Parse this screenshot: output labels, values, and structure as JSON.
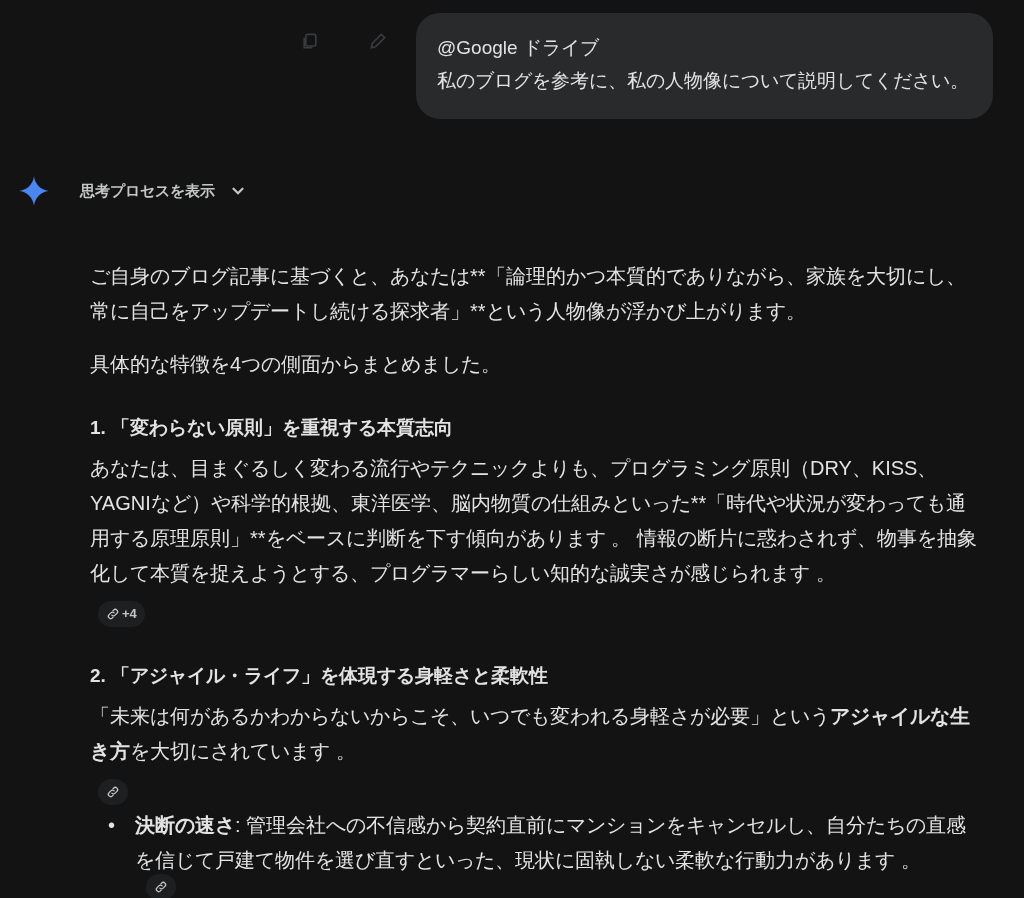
{
  "message_actions": [
    {
      "kind": "copy"
    },
    {
      "kind": "edit"
    }
  ],
  "user_message": {
    "mention": "@Google ドライブ",
    "text": "私のブログを参考に、私の人物像について説明してください。"
  },
  "thinking_toggle": {
    "label": "思考プロセスを表示",
    "expanded": false
  },
  "response": [
    {
      "kind": "plain",
      "text": "ご自身のブログ記事に基づくと、あなたは**「論理的かつ本質的でありながら、家族を大切にし、常に自己をアップデートし続ける探求者」**という人物像が浮かび上がります。"
    },
    {
      "kind": "plain",
      "text": "具体的な特徴を4つの側面からまとめました。"
    },
    {
      "kind": "heading",
      "text": "1. 「変わらない原則」を重視する本質志向"
    },
    {
      "kind": "plain",
      "text": "あなたは、目まぐるしく変わる流行やテクニックよりも、プログラミング原則（DRY、KISS、YAGNIなど）や科学的根拠、東洋医学、脳内物質の仕組みといった**「時代や状況が変わっても通用する原理原則」**をベースに判断を下す傾向があります 。 情報の断片に惑わされず、物事を抽象化して本質を捉えようとする、プログラマーらしい知的な誠実さが感じられます 。"
    },
    {
      "kind": "citation",
      "label": "+4"
    },
    {
      "kind": "heading",
      "text": "2. 「アジャイル・ライフ」を体現する身軽さと柔軟性"
    },
    {
      "kind": "rich",
      "text": "「未来は何があるかわからないからこそ、いつでも変われる身軽さが必要」という**アジャイルな生き方**を大切にされています 。"
    },
    {
      "kind": "citation"
    },
    {
      "kind": "bullet",
      "marker": "•",
      "text": "**決断の速さ**: 管理会社への不信感から契約直前にマンションをキャンセルし、自分たちの直感を信じて戸建て物件を選び直すといった、現状に固執しない柔軟な行動力があります 。"
    },
    {
      "kind": "citation"
    }
  ]
}
